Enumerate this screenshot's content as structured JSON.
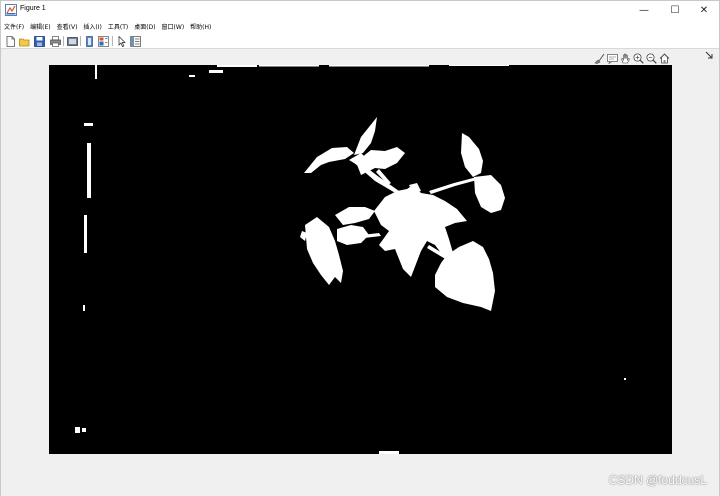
{
  "window": {
    "title": "Figure 1",
    "minimize_glyph": "—",
    "maximize_glyph": "☐",
    "close_glyph": "✕"
  },
  "menu": [
    {
      "label": "文件(F)"
    },
    {
      "label": "编辑(E)"
    },
    {
      "label": "查看(V)"
    },
    {
      "label": "插入(I)"
    },
    {
      "label": "工具(T)"
    },
    {
      "label": "桌面(D)"
    },
    {
      "label": "窗口(W)"
    },
    {
      "label": "帮助(H)"
    }
  ],
  "toolbar": {
    "icons": [
      "new-figure-icon",
      "open-file-icon",
      "save-icon",
      "print-icon",
      "print-preview-icon",
      "link-plot-icon",
      "insert-colorbar-icon",
      "edit-plot-arrow-icon",
      "property-inspector-icon"
    ]
  },
  "axes_toolbar": {
    "icons": [
      "brush-icon",
      "data-tips-icon",
      "pan-hand-icon",
      "zoom-in-icon",
      "zoom-out-icon",
      "home-restore-icon"
    ]
  },
  "image": {
    "type": "binary-mask",
    "background_color": "#000000",
    "foreground_color": "#ffffff"
  },
  "watermark": "CSDN @foddcusL"
}
